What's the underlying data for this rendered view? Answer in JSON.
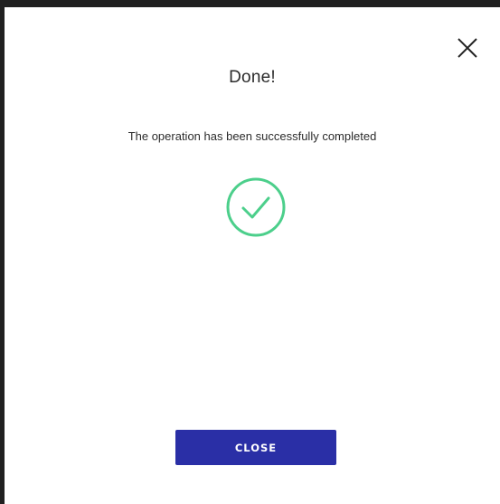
{
  "dialog": {
    "title": "Done!",
    "message": "The operation has been successfully completed",
    "close_button_label": "CLOSE",
    "close_icon": "close-icon",
    "status_icon": "check-circle-icon",
    "accent_color": "#4ccf8b",
    "button_color": "#2a2fa6"
  }
}
